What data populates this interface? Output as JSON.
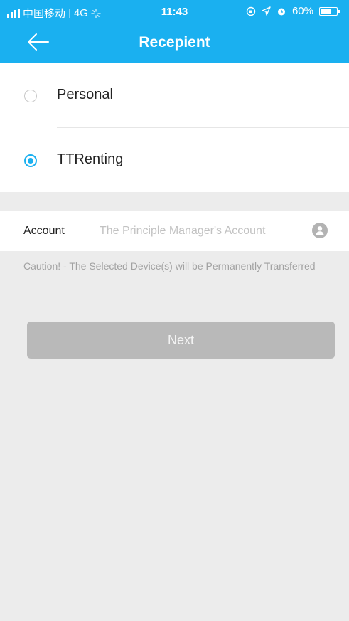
{
  "status_bar": {
    "carrier": "中国移动",
    "network": "4G",
    "time": "11:43",
    "battery": "60%",
    "battery_level": 0.6
  },
  "nav": {
    "title": "Recepient",
    "back_icon": "back-arrow-icon"
  },
  "recipient_options": [
    {
      "label": "Personal",
      "selected": false
    },
    {
      "label": "TTRenting",
      "selected": true
    }
  ],
  "account": {
    "label": "Account",
    "value": "",
    "placeholder": "The Principle Manager's Account",
    "icon": "contact-icon"
  },
  "caution_text": "Caution! - The Selected Device(s) will be Permanently Transferred",
  "next_button": {
    "label": "Next",
    "enabled": false
  },
  "colors": {
    "accent": "#1ab0f0",
    "background": "#ececec",
    "button_disabled": "#b9b9b9"
  }
}
